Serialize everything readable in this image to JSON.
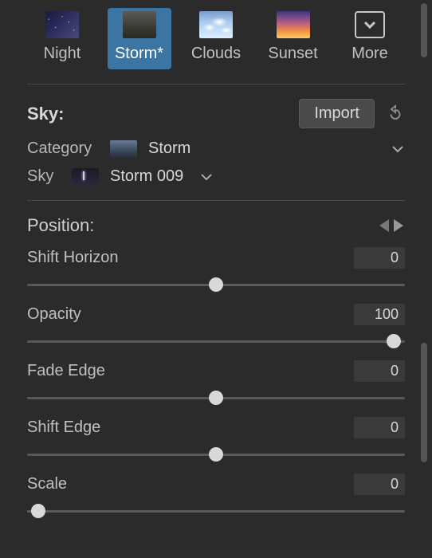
{
  "presets": [
    {
      "label": "Night"
    },
    {
      "label": "Storm*"
    },
    {
      "label": "Clouds"
    },
    {
      "label": "Sunset"
    },
    {
      "label": "More"
    }
  ],
  "sky_section": {
    "title": "Sky:",
    "import_label": "Import",
    "category_label": "Category",
    "category_value": "Storm",
    "sky_label": "Sky",
    "sky_value": "Storm 009"
  },
  "position_section": {
    "title": "Position:"
  },
  "sliders": {
    "shift_horizon": {
      "label": "Shift Horizon",
      "value": "0",
      "pos": 50
    },
    "opacity": {
      "label": "Opacity",
      "value": "100",
      "pos": 97
    },
    "fade_edge": {
      "label": "Fade Edge",
      "value": "0",
      "pos": 50
    },
    "shift_edge": {
      "label": "Shift Edge",
      "value": "0",
      "pos": 50
    },
    "scale": {
      "label": "Scale",
      "value": "0",
      "pos": 3
    }
  }
}
